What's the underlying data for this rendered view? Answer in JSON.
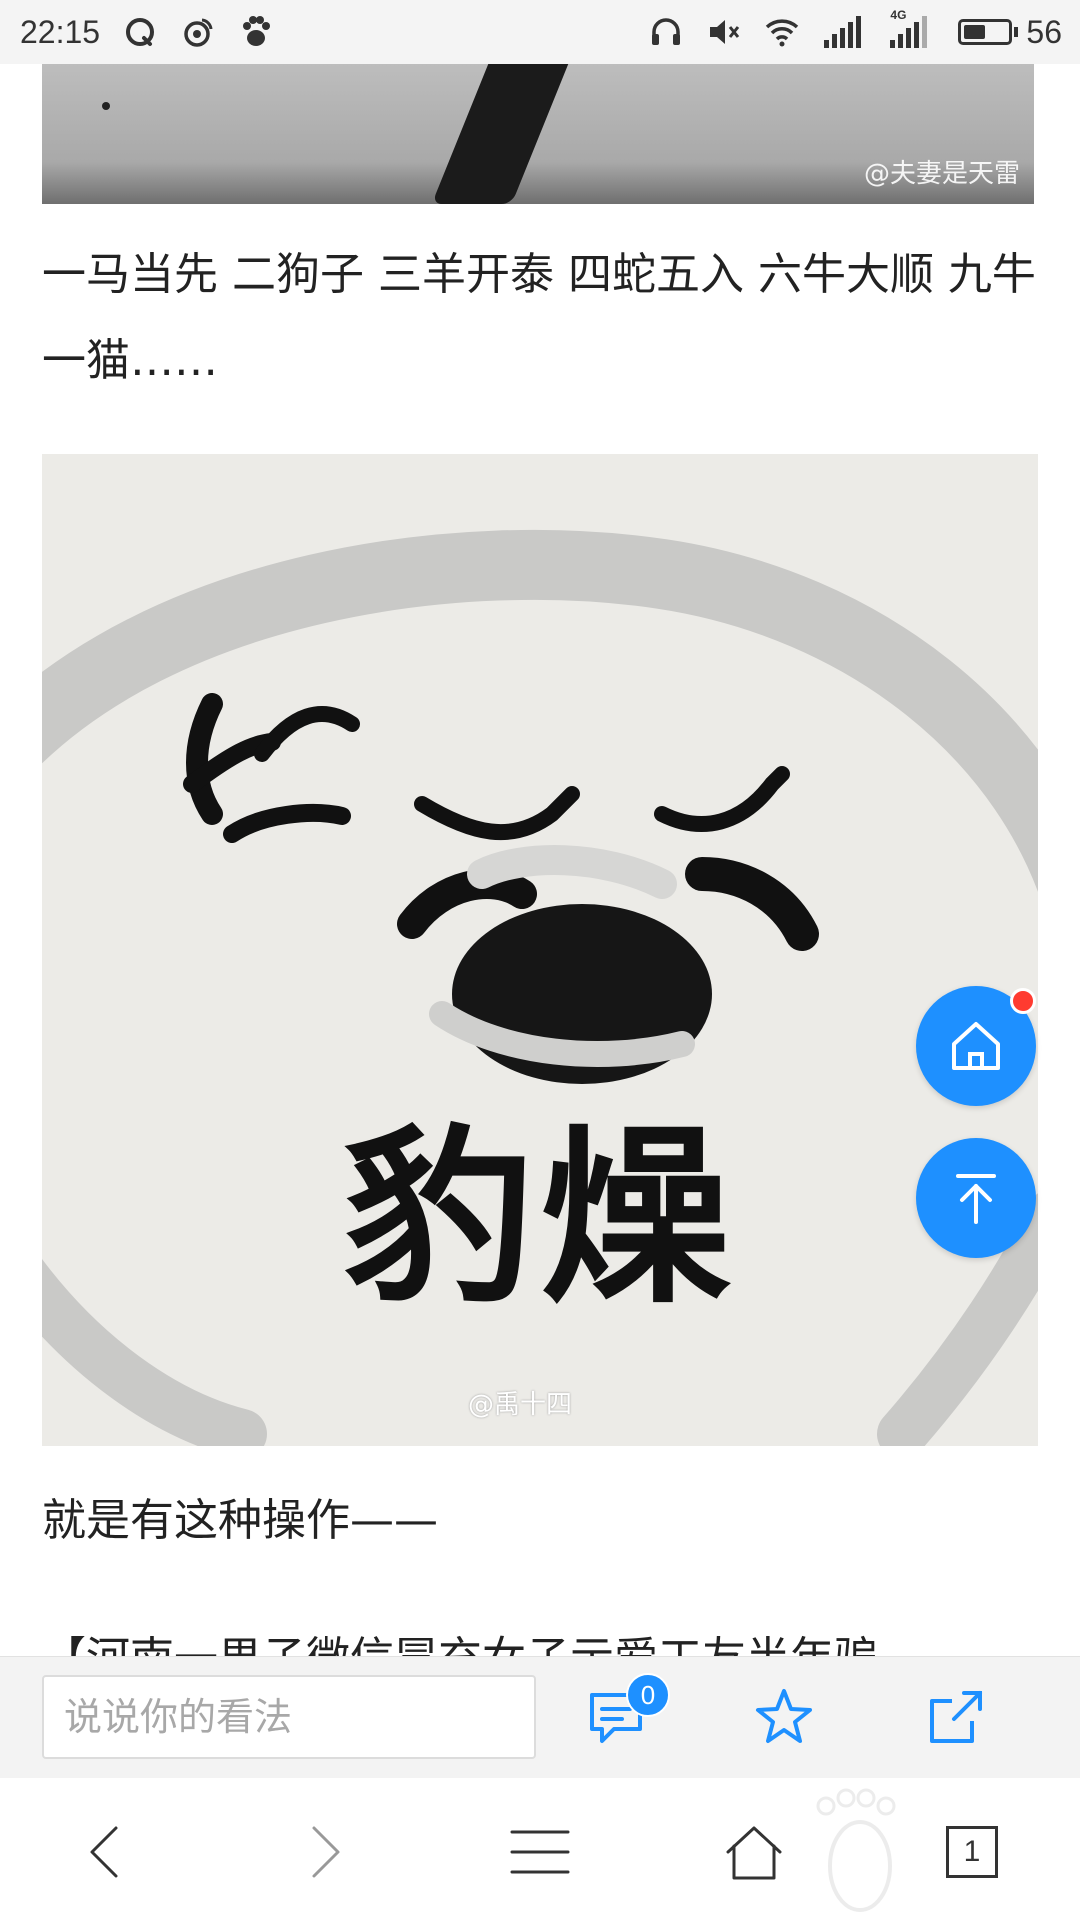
{
  "status_bar": {
    "time": "22:15",
    "battery_level": "56",
    "network_type": "4G",
    "left_icons": [
      "qq-icon",
      "weibo-icon",
      "baidu-paw-icon"
    ],
    "right_icons": [
      "headphones-icon",
      "mute-icon",
      "wifi-icon",
      "signal-icon",
      "signal-4g-icon",
      "battery-icon"
    ]
  },
  "article": {
    "top_image_watermark": "@夫妻是天雷",
    "paragraph_1": "一马当先  二狗子  三羊开泰  四蛇五入  六牛大顺 九牛一猫……",
    "meme_text": "豹燥",
    "meme_watermark": "@禹十四",
    "paragraph_2": "就是有这种操作——",
    "paragraph_3": "【河南一男子微信冒充女子示爱工友半年骗"
  },
  "floating_buttons": {
    "home_icon": "home-icon",
    "back_to_top_icon": "arrow-up-icon",
    "notification_dot_color": "#ff3b30"
  },
  "comment_bar": {
    "input_placeholder": "说说你的看法",
    "comment_count": "0",
    "icons": [
      "comment-icon",
      "star-icon",
      "share-icon"
    ]
  },
  "browser_nav": {
    "tab_count": "1",
    "icons": [
      "back-icon",
      "forward-icon",
      "menu-icon",
      "home-icon",
      "tabs-icon"
    ]
  },
  "colors": {
    "accent": "#1e90ff",
    "status_bar_bg": "#f4f4f4",
    "text": "#222222"
  }
}
